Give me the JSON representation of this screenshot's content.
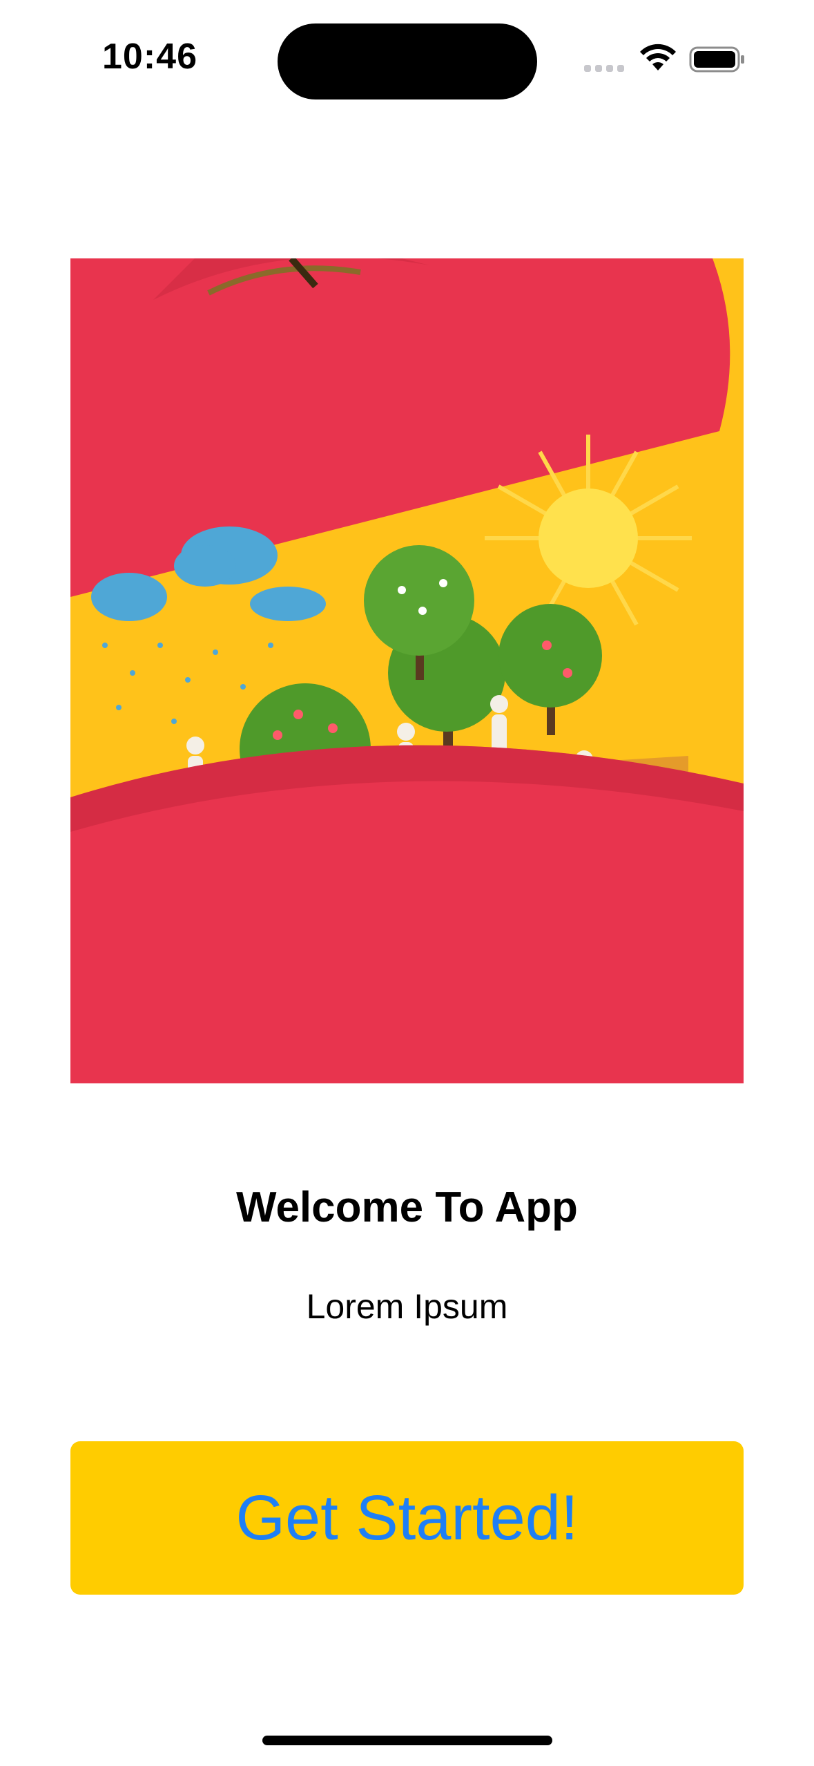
{
  "status_bar": {
    "time": "10:46",
    "icons": [
      "cellular-signal-icon",
      "wifi-icon",
      "battery-icon"
    ]
  },
  "hero": {
    "image_name": "apple-orchard-illustration",
    "colors": {
      "background": "#ffc21a",
      "apple": "#e8344e",
      "tree": "#4f9a2a",
      "water": "#3b92c4"
    }
  },
  "welcome": {
    "title": "Welcome To App",
    "subtitle": "Lorem Ipsum"
  },
  "cta": {
    "label": "Get Started!",
    "background": "#ffcc00",
    "text_color": "#1e7ff5"
  }
}
